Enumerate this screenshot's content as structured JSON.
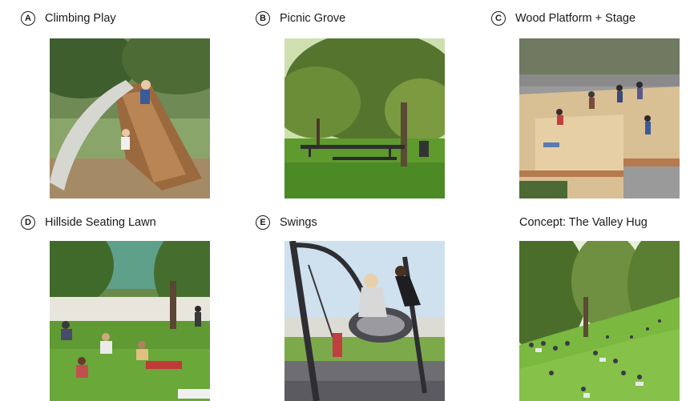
{
  "panels": [
    {
      "badge": "A",
      "title": "Climbing Play"
    },
    {
      "badge": "B",
      "title": "Picnic Grove"
    },
    {
      "badge": "C",
      "title": "Wood Platform + Stage"
    },
    {
      "badge": "D",
      "title": "Hillside Seating Lawn"
    },
    {
      "badge": "E",
      "title": "Swings"
    },
    {
      "badge": "",
      "title": "Concept: The Valley Hug"
    }
  ]
}
